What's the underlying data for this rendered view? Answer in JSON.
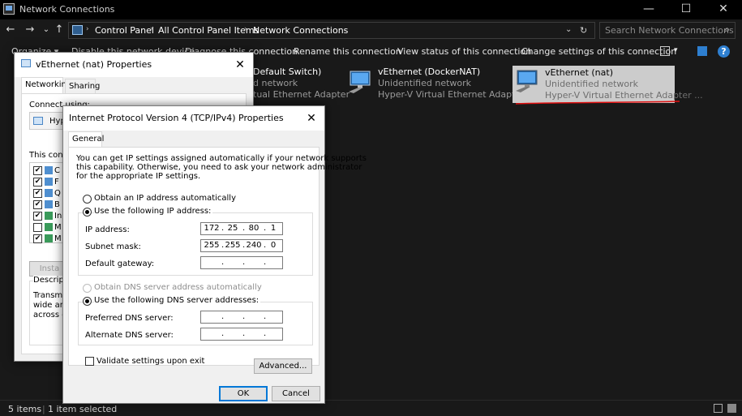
{
  "window": {
    "title": "Network Connections",
    "minimize": "—",
    "maximize": "☐",
    "close": "✕"
  },
  "nav": {
    "back": "←",
    "forward": "→",
    "recent": "⌄",
    "up": "↑",
    "breadcrumb_sep": "›",
    "breadcrumb": [
      "Control Panel",
      "All Control Panel Items",
      "Network Connections"
    ],
    "dropdown": "⌄",
    "refresh": "↻"
  },
  "search": {
    "placeholder": "Search Network Connections",
    "icon": "⌕"
  },
  "commands": {
    "organize": "Organize ▾",
    "disable": "Disable this network device",
    "diagnose": "Diagnose this connection",
    "rename": "Rename this connection",
    "view_status": "View status of this connection",
    "change_settings": "Change settings of this connection",
    "view_options": "▾",
    "help": "?"
  },
  "adapters": [
    {
      "name": "Default Switch)",
      "status": "d network",
      "device": "tual Ethernet Adapter"
    },
    {
      "name": "vEthernet (DockerNAT)",
      "status": "Unidentified network",
      "device": "Hyper-V Virtual Ethernet Adapter ..."
    },
    {
      "name": "vEthernet (nat)",
      "status": "Unidentified network",
      "device": "Hyper-V Virtual Ethernet Adapter ..."
    }
  ],
  "status_bar": {
    "items": "5 items",
    "selected": "1 item selected"
  },
  "props_dialog": {
    "title": "vEthernet (nat) Properties",
    "tabs": [
      "Networking",
      "Sharing"
    ],
    "connect_using": "Connect using:",
    "adapter_partial": "Hyp",
    "this_conn": "This conne",
    "install_partial": "Insta",
    "descr_partial": "Descripti",
    "descr_lines": [
      "Transmi",
      "wide are",
      "across d"
    ],
    "items": [
      {
        "checked": true,
        "label": "C"
      },
      {
        "checked": true,
        "label": "F"
      },
      {
        "checked": true,
        "label": "Q"
      },
      {
        "checked": true,
        "label": "B"
      },
      {
        "checked": true,
        "label": "In"
      },
      {
        "checked": false,
        "label": "M"
      },
      {
        "checked": true,
        "label": "M"
      }
    ]
  },
  "ipv4_dialog": {
    "title": "Internet Protocol Version 4 (TCP/IPv4) Properties",
    "tab": "General",
    "intro": [
      "You can get IP settings assigned automatically if your network supports",
      "this capability. Otherwise, you need to ask your network administrator",
      "for the appropriate IP settings."
    ],
    "obtain_ip": "Obtain an IP address automatically",
    "use_ip": "Use the following IP address:",
    "ip_label": "IP address:",
    "ip": [
      "172",
      "25",
      "80",
      "1"
    ],
    "mask_label": "Subnet mask:",
    "mask": [
      "255",
      "255",
      "240",
      "0"
    ],
    "gateway_label": "Default gateway:",
    "obtain_dns": "Obtain DNS server address automatically",
    "use_dns": "Use the following DNS server addresses:",
    "pref_dns_label": "Preferred DNS server:",
    "alt_dns_label": "Alternate DNS server:",
    "validate": "Validate settings upon exit",
    "advanced": "Advanced...",
    "ok": "OK",
    "cancel": "Cancel",
    "close": "✕",
    "dot": "."
  },
  "colors": {
    "accent": "#0078d7",
    "annotation": "#e01010"
  }
}
